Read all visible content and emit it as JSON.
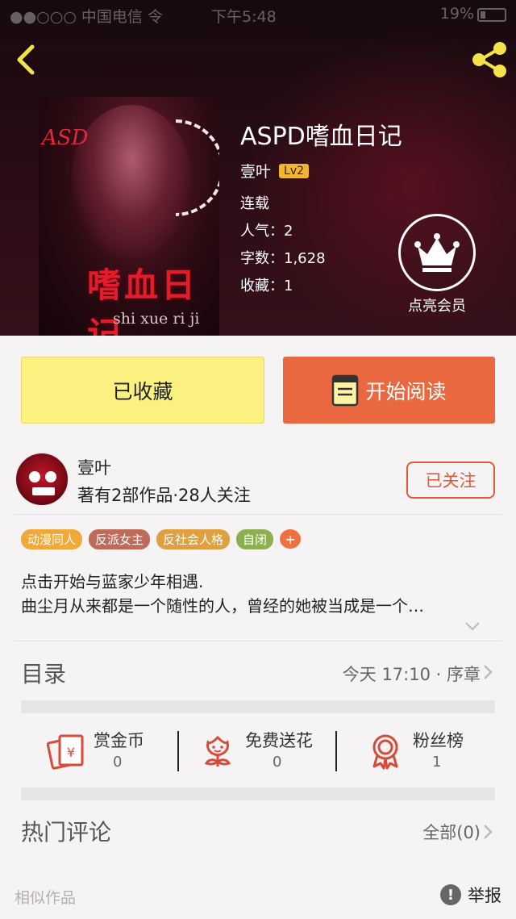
{
  "status_bar": {
    "carrier": "●●○○○ 中国电信 令",
    "time": "下午5:48",
    "battery": "19%"
  },
  "book": {
    "title": "ASPD嗜血日记",
    "author": "壹叶",
    "level": "Lv2",
    "status": "连载",
    "popularity": "人气：2",
    "word_count": "字数：1,628",
    "favorites": "收藏：1",
    "cover": {
      "logo_text": "ASD",
      "title_text": "嗜血日记",
      "subtitle_text": "shi xue ri ji"
    }
  },
  "vip": {
    "label": "点亮会员"
  },
  "actions": {
    "favorite_label": "已收藏",
    "read_label": "开始阅读"
  },
  "author_card": {
    "name": "壹叶",
    "stats": "著有2部作品·28人关注",
    "follow_label": "已关注"
  },
  "tags": [
    {
      "label": "动漫同人",
      "color": "#f0a838"
    },
    {
      "label": "反派女主",
      "color": "#c06a5a"
    },
    {
      "label": "反社会人格",
      "color": "#e0a040"
    },
    {
      "label": "自闭",
      "color": "#8cb050"
    },
    {
      "label": "+",
      "color": "#f07040"
    }
  ],
  "description": {
    "line1": "点击开始与蓝家少年相遇.",
    "line2": "曲尘月从来都是一个随性的人，曾经的她被当成是一个…"
  },
  "catalog": {
    "title": "目录",
    "latest": "今天 17:10 · 序章"
  },
  "stats": [
    {
      "label": "赏金币",
      "value": "0",
      "icon": "coin-envelope-icon"
    },
    {
      "label": "免费送花",
      "value": "0",
      "icon": "flower-icon"
    },
    {
      "label": "粉丝榜",
      "value": "1",
      "icon": "rosette-icon"
    }
  ],
  "comments": {
    "title": "热门评论",
    "all_label": "全部(0)"
  },
  "footer": {
    "similar_label": "相似作品",
    "report_label": "举报"
  },
  "colors": {
    "accent_orange": "#e9683f",
    "fav_yellow": "#fbf180",
    "icon_red": "#d94a3a"
  }
}
